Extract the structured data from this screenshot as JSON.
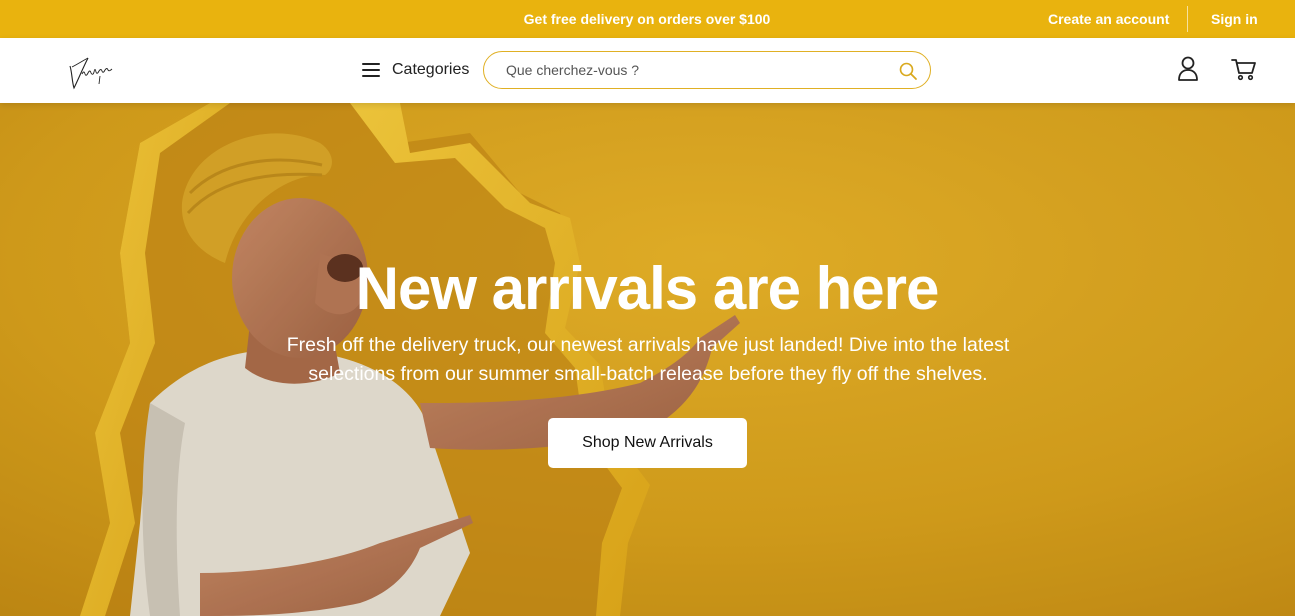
{
  "topbar": {
    "promo": "Get free delivery on orders over $100",
    "create_account": "Create an account",
    "sign_in": "Sign in",
    "background": "#e9b30e"
  },
  "nav": {
    "logo": "Vintique",
    "categories_label": "Categories",
    "search_placeholder": "Que cherchez-vous ?",
    "icons": [
      "menu-icon",
      "search-icon",
      "user-icon",
      "cart-icon"
    ]
  },
  "hero": {
    "title": "New arrivals are here",
    "subtitle": "Fresh off the delivery truck, our newest arrivals have just landed! Dive into the latest selections from our summer small-batch release before they fly off the shelves.",
    "button_label": "Shop New Arrivals",
    "accent": "#e0a91a"
  }
}
